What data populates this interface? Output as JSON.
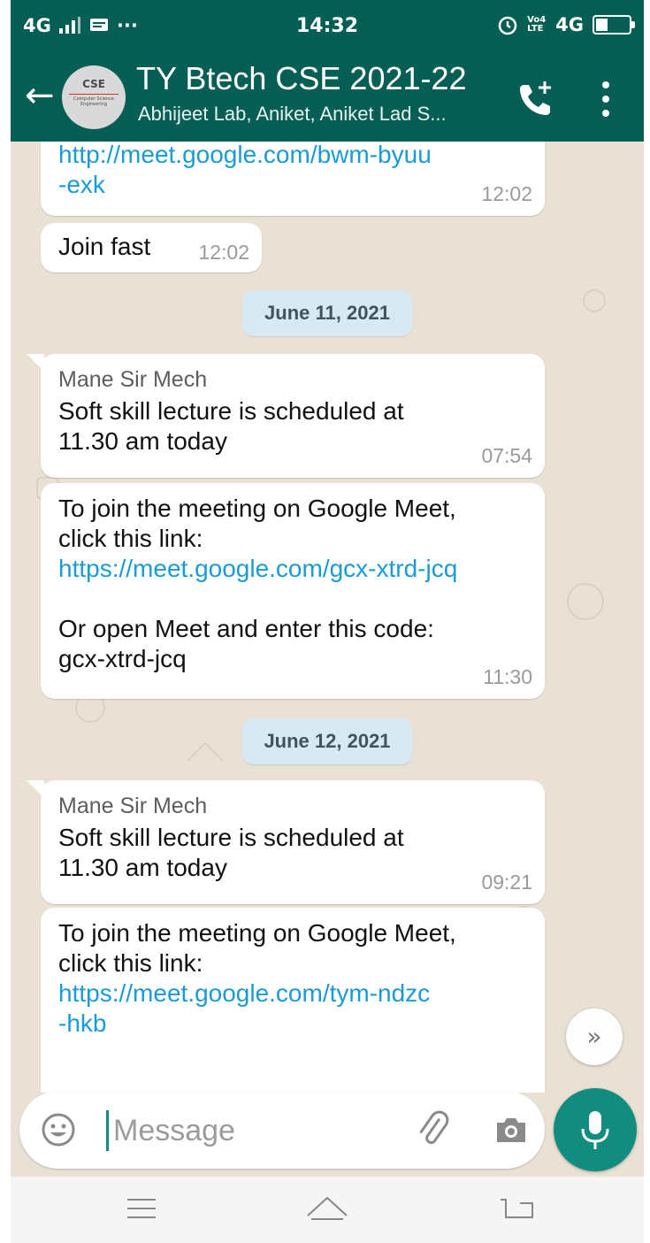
{
  "status_bar": {
    "network_left": "4G",
    "more": "···",
    "time": "14:32",
    "volte": "Vo4 LTE",
    "network_right": "4G",
    "battery_level": 0.35
  },
  "header": {
    "back_icon": "arrow-left-icon",
    "avatar_line1": "CSE",
    "avatar_line2": "Computer Science Engineering",
    "title": "TY Btech CSE 2021-22",
    "subtitle": "Abhijeet Lab, Aniket, Aniket Lad S...",
    "call_icon": "add-call-icon",
    "menu_icon": "more-vertical-icon"
  },
  "messages": [
    {
      "link": "http://meet.google.com/bwm-byuu\n-exk",
      "time": "12:02"
    },
    {
      "text": "Join fast",
      "time": "12:02"
    },
    {
      "date": "June 11, 2021"
    },
    {
      "sender": "Mane Sir Mech",
      "text": "Soft skill lecture is  scheduled at\n11.30 am today",
      "time": "07:54"
    },
    {
      "text1": "To join the meeting on Google Meet,\nclick this link:",
      "link": "https://meet.google.com/gcx-xtrd-jcq",
      "text2": "Or open Meet and enter this code:\ngcx-xtrd-jcq",
      "time": "11:30"
    },
    {
      "date": "June 12, 2021"
    },
    {
      "sender": "Mane Sir Mech",
      "text": "Soft skill lecture is  scheduled at\n11.30 am today",
      "time": "09:21"
    },
    {
      "text1": "To join the meeting on Google Meet,\nclick this link:",
      "link": "https://meet.google.com/tym-ndzc\n-hkb"
    }
  ],
  "scroll_down_icon": "chevron-double-down-icon",
  "input": {
    "placeholder": "Message",
    "emoji_icon": "emoji-icon",
    "attach_icon": "paperclip-icon",
    "camera_icon": "camera-icon",
    "mic_icon": "microphone-icon"
  },
  "navbar": {
    "menu_icon": "menu-icon",
    "home_icon": "home-icon",
    "back_icon": "back-icon"
  },
  "colors": {
    "header": "#075e54",
    "accent": "#128c7e",
    "link": "#1a9bd7",
    "date_chip": "#d7eaf3"
  }
}
